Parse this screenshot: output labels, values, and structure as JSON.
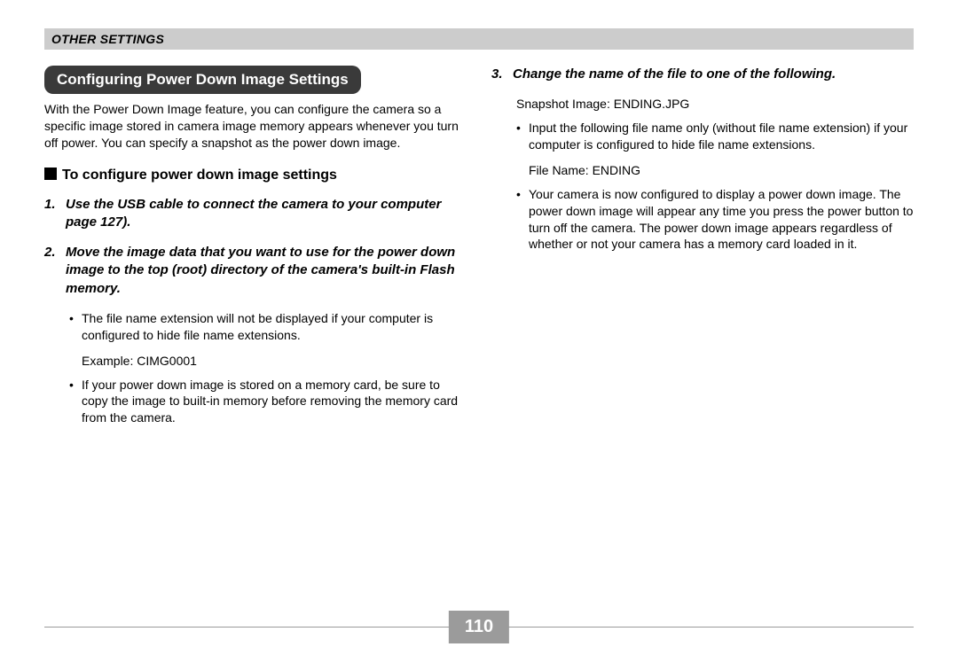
{
  "header": "OTHER SETTINGS",
  "left": {
    "section_title": "Configuring Power Down Image Settings",
    "intro": "With the Power Down Image feature, you can configure the camera so a specific image stored in camera image memory appears whenever you turn off power. You can specify a snapshot as the power down image.",
    "sub_heading": "To configure power down image settings",
    "step1_num": "1.",
    "step1_text": "Use the USB cable to connect the camera to your computer page 127).",
    "step2_num": "2.",
    "step2_text": "Move the image data that you want to use for the power down image to the top (root) directory of the camera's built-in Flash memory.",
    "bullet1": "The file name extension will not be displayed if your computer is configured to hide file name extensions.",
    "example": "Example: CIMG0001",
    "bullet2": "If your power down image is stored on a memory card, be sure to copy the image to built-in memory before removing the memory card from the camera."
  },
  "right": {
    "step3_num": "3.",
    "step3_text": "Change the name of the file to one of the following.",
    "snapshot_line": "Snapshot Image: ENDING.JPG",
    "bullet1": "Input the following file name only (without file name extension) if your computer is configured to hide file name extensions.",
    "file_name_line": "File Name: ENDING",
    "bullet2": "Your camera is now configured to display a power down image. The power down image will appear any time you press the power button to turn off the camera. The power down image appears regardless of whether or not your camera has a memory card loaded in it."
  },
  "page_number": "110"
}
